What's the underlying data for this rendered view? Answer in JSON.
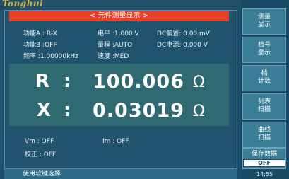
{
  "brand": "Tonghui",
  "title": "< 元件测量显示 >",
  "params": {
    "func_a": "功能A : R-X",
    "level": "电平  :1.000 V",
    "dc_bias": "DC偏置: 0.00   mV",
    "func_b": "功能B :OFF",
    "range": "量程  :AUTO",
    "dc_source": "DC电源: 0.000 V",
    "freq": "频率  :1.00000kHz",
    "speed": "速度  :MED"
  },
  "measurement": {
    "r_label": "R",
    "r_value": "100.006",
    "r_unit": "Ω",
    "x_label": "X",
    "x_value": "0.03019",
    "x_unit": "Ω",
    "colon": ":"
  },
  "info": {
    "vm": "Vm   : OFF",
    "im": "Im   : OFF",
    "correction": "校正 : OFF"
  },
  "status": "使用软键选择",
  "softkeys": [
    {
      "line1": "测量",
      "line2": "显示"
    },
    {
      "line1": "档号",
      "line2": "显示"
    },
    {
      "line1": "档",
      "line2": "计数"
    },
    {
      "line1": "列表",
      "line2": "扫描"
    },
    {
      "line1": "曲线",
      "line2": "扫描"
    },
    {
      "line1": "保存数据",
      "line2": "OFF"
    }
  ],
  "time": "14:55"
}
